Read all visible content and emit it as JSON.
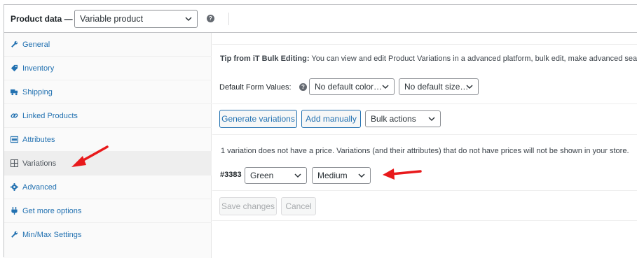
{
  "header": {
    "title": "Product data —",
    "product_type": "Variable product",
    "help_icon": "question-icon"
  },
  "sidebar": {
    "items": [
      {
        "label": "General",
        "icon": "wrench-icon"
      },
      {
        "label": "Inventory",
        "icon": "tag-icon"
      },
      {
        "label": "Shipping",
        "icon": "truck-icon"
      },
      {
        "label": "Linked Products",
        "icon": "link-icon"
      },
      {
        "label": "Attributes",
        "icon": "list-icon"
      },
      {
        "label": "Variations",
        "icon": "grid-icon",
        "active": true
      },
      {
        "label": "Advanced",
        "icon": "gear-icon"
      },
      {
        "label": "Get more options",
        "icon": "plugin-icon"
      },
      {
        "label": "Min/Max Settings",
        "icon": "wrench-icon"
      }
    ]
  },
  "main": {
    "tip_bold": "Tip from iT Bulk Editing:",
    "tip_text": " You can view and edit Product Variations in a advanced platform, bulk edit, make advanced searches",
    "default_form_values_label": "Default Form Values:",
    "default_color": "No default color…",
    "default_size": "No default size…",
    "generate_button": "Generate variations",
    "add_manually_button": "Add manually",
    "bulk_actions": "Bulk actions",
    "notice": "1 variation does not have a price. Variations (and their attributes) that do not have prices will not be shown in your store.",
    "variation": {
      "id": "#3383",
      "color": "Green",
      "size": "Medium"
    },
    "save_button": "Save changes",
    "cancel_button": "Cancel"
  },
  "colors": {
    "accent": "#2271b1",
    "annotation_arrow": "#e8191b"
  }
}
